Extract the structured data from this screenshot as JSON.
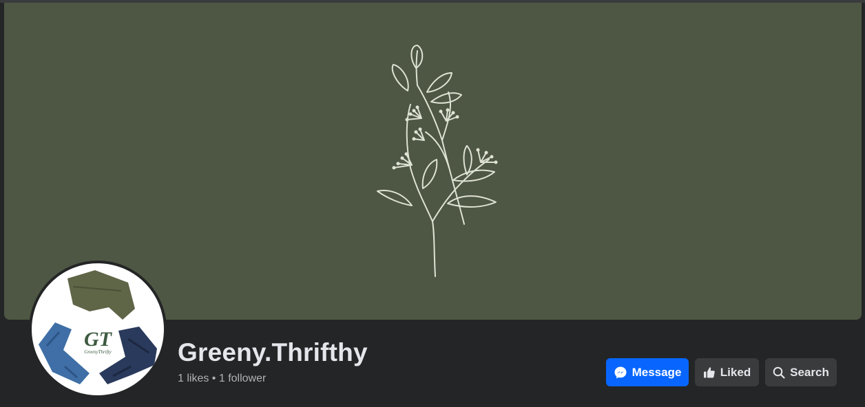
{
  "cover": {
    "background_color": "#4e5743",
    "illustration": "botanical-sprig-line-drawing"
  },
  "profile": {
    "avatar_monogram": "GT",
    "avatar_wordmark": "GreenyThrifty",
    "name": "Greeny.Thrifthy",
    "stats": "1 likes • 1 follower"
  },
  "actions": {
    "message_label": "Message",
    "message_icon": "messenger-icon",
    "liked_label": "Liked",
    "liked_icon": "thumbs-up-icon",
    "search_label": "Search",
    "search_icon": "search-icon",
    "accent_color": "#0866ff"
  }
}
